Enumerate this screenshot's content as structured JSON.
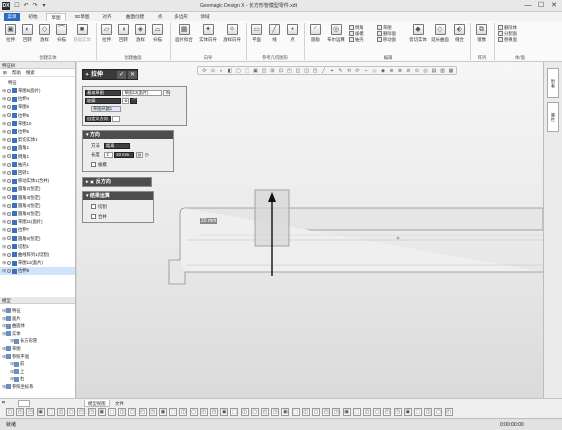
{
  "window": {
    "logo": "DX",
    "title": "Geomagic Design X - 长方形管模型零件.xdt"
  },
  "quick_access": [
    "☐",
    "↶",
    "↷",
    "▾"
  ],
  "window_controls": [
    "—",
    "☐",
    "✕"
  ],
  "ribbon_tabs": [
    "菜单",
    "初始",
    "草图",
    "3D草图",
    "对齐",
    "曲面创建",
    "点",
    "多边形",
    "领域"
  ],
  "ribbon_groups": [
    "创建实体",
    "创建曲面",
    "向导",
    "参考几何图形",
    "编辑",
    "阵列",
    "体/面"
  ],
  "ribbon_buttons": [
    "拉伸",
    "回转",
    "放样",
    "扫描",
    "基础实体",
    "拉伸",
    "回转",
    "放样",
    "扫描",
    "面片拟合",
    "实体向导",
    "放样向导",
    "平面",
    "线",
    "点",
    "圆角",
    "布尔运算",
    "剪切实体",
    "延长曲面",
    "缝合",
    "镜像"
  ],
  "ribbon_small": [
    "倒角",
    "草图",
    "拔模",
    "抽壳",
    "移动面",
    "删除面",
    "替换面",
    "曲线",
    "删除体",
    "分割面",
    "切割"
  ],
  "left_panel": {
    "header": "特征树",
    "toolbar": [
      "⊞",
      "帮助",
      "搜索"
    ],
    "root": "特征",
    "items": [
      "草图5(面片)",
      "拉伸4",
      "草图6",
      "拉伸5",
      "草图10",
      "拉伸6",
      "剪切实体1",
      "圆角1",
      "倒角1",
      "抽壳1",
      "回转1",
      "移动实体1(合并)",
      "圆角2(恒定)",
      "圆角3(恒定)",
      "圆角4(恒定)",
      "圆角5(恒定)",
      "草图11(面片)",
      "拉伸7",
      "圆角6(恒定)",
      "切割1",
      "曲线阵列1(切割)",
      "草图12(面片)",
      "拉伸8"
    ],
    "model_header": "模型",
    "model_items": [
      "特征",
      "面片",
      "曲面体",
      "实体",
      "长方形管",
      "草图",
      "参照平面",
      "前",
      "上",
      "右",
      "参照坐标系"
    ]
  },
  "dialog": {
    "title": "拉伸",
    "ok": "✓",
    "cancel": "✕",
    "base_sketch_label": "基准草图",
    "base_sketch_value": "草图12(面片)",
    "contour_label": "轮廓",
    "contour_value": "",
    "reverse_label": "草图环路1",
    "user_axis": "自定义方向",
    "method_section": "方向",
    "method_label": "方法",
    "method_value": "距离",
    "length_label": "长度",
    "length_value": "20 mm",
    "draft_label": "拔模",
    "reverse_dir": "反方向",
    "result_section": "结果运算",
    "cut": "切割",
    "merge": "合并"
  },
  "viewport": {
    "dimension": "20 mm"
  },
  "right_tabs": [
    "附着",
    "属性"
  ],
  "bottom_tabs": [
    "模型视图",
    "文件"
  ],
  "status_left": "就绪",
  "status_right": "0:00:00:00"
}
